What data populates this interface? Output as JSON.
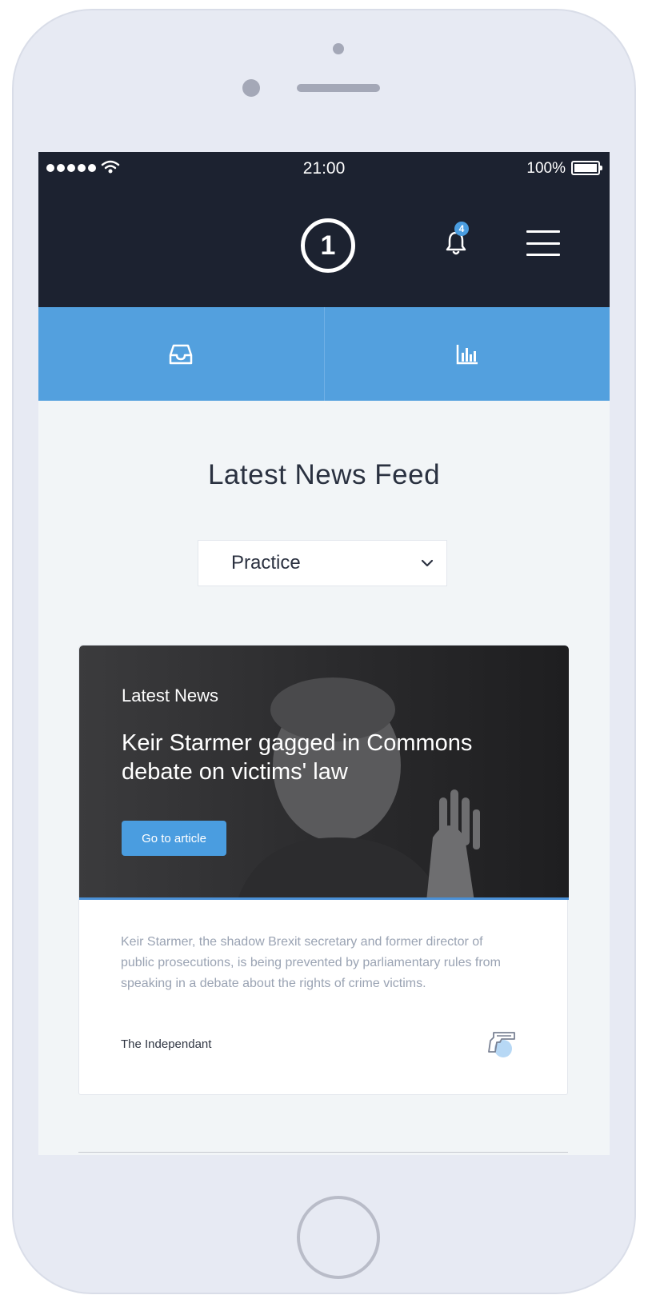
{
  "status_bar": {
    "time": "21:00",
    "battery_percent": "100%"
  },
  "header": {
    "logo_text": "1",
    "notification_count": "4",
    "icons": [
      "signal-dots",
      "wifi-icon",
      "battery-icon",
      "logo-icon",
      "bell-icon",
      "hamburger-menu-icon"
    ]
  },
  "tabs": [
    {
      "icon": "inbox-icon"
    },
    {
      "icon": "bar-chart-icon"
    }
  ],
  "main": {
    "heading": "Latest News Feed",
    "filter": {
      "selected": "Practice"
    }
  },
  "card": {
    "eyebrow": "Latest News",
    "title": "Keir Starmer gagged in Commons debate on victims' law",
    "button_label": "Go to article",
    "summary": "Keir Starmer, the shadow Brexit secretary and former director of public prosecutions, is being prevented by parliamentary rules from speaking in a debate about the rights of crime victims.",
    "source": "The Independant",
    "category_icon": "gun-icon"
  },
  "colors": {
    "header_bg": "#1c2230",
    "tab_bg": "#53a0de",
    "accent": "#4a9de0",
    "page_bg": "#f2f5f7",
    "phone_frame": "#e7eaf3"
  }
}
